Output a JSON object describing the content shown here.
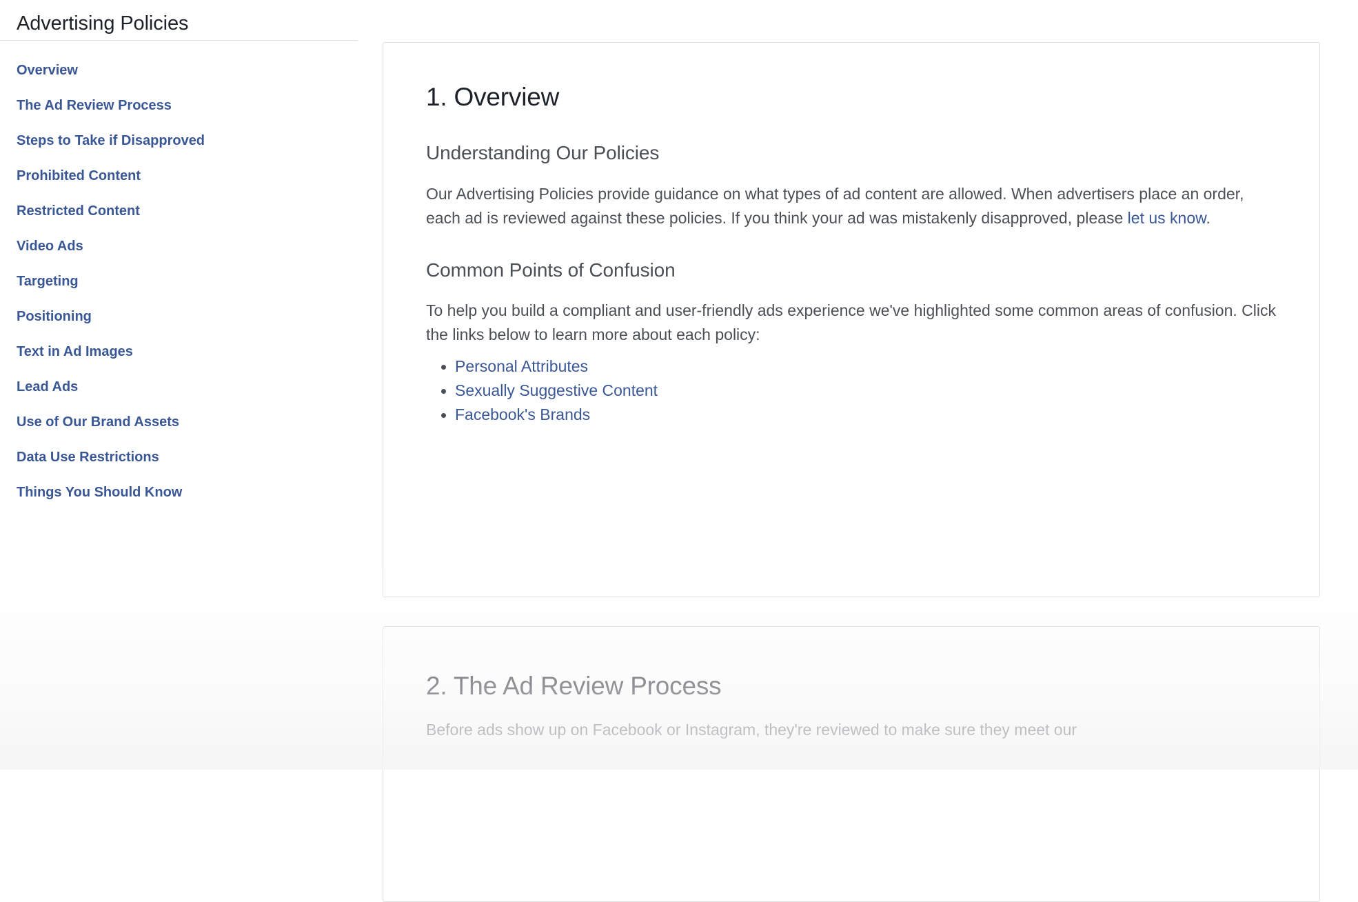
{
  "page": {
    "title": "Advertising Policies"
  },
  "colors": {
    "link": "#3a5795",
    "heading": "#1d2129",
    "body_text": "#4b4f56",
    "card_border": "#dddfe2",
    "divider": "#dcdee1",
    "background": "#ffffff"
  },
  "sidebar": {
    "items": [
      {
        "label": "Overview"
      },
      {
        "label": "The Ad Review Process"
      },
      {
        "label": "Steps to Take if Disapproved"
      },
      {
        "label": "Prohibited Content"
      },
      {
        "label": "Restricted Content"
      },
      {
        "label": "Video Ads"
      },
      {
        "label": "Targeting"
      },
      {
        "label": "Positioning"
      },
      {
        "label": "Text in Ad Images"
      },
      {
        "label": "Lead Ads"
      },
      {
        "label": "Use of Our Brand Assets"
      },
      {
        "label": "Data Use Restrictions"
      },
      {
        "label": "Things You Should Know"
      }
    ]
  },
  "sections": {
    "overview": {
      "heading": "1. Overview",
      "sub_heading_1": "Understanding Our Policies",
      "paragraph_1_part_1": "Our Advertising Policies provide guidance on what types of ad content are allowed. When advertisers place an order, each ad is reviewed against these policies. If you think your ad was mistakenly disapproved, please ",
      "paragraph_1_link": "let us know",
      "paragraph_1_part_2": ".",
      "sub_heading_2": "Common Points of Confusion",
      "paragraph_2": "To help you build a compliant and user-friendly ads experience we've highlighted some common areas of confusion. Click the links below to learn more about each policy:",
      "links": [
        {
          "label": "Personal Attributes"
        },
        {
          "label": "Sexually Suggestive Content"
        },
        {
          "label": "Facebook's Brands"
        }
      ]
    },
    "ad_review_process": {
      "heading": "2. The Ad Review Process",
      "paragraph_1": "Before ads show up on Facebook or Instagram, they're reviewed to make sure they meet our"
    }
  }
}
